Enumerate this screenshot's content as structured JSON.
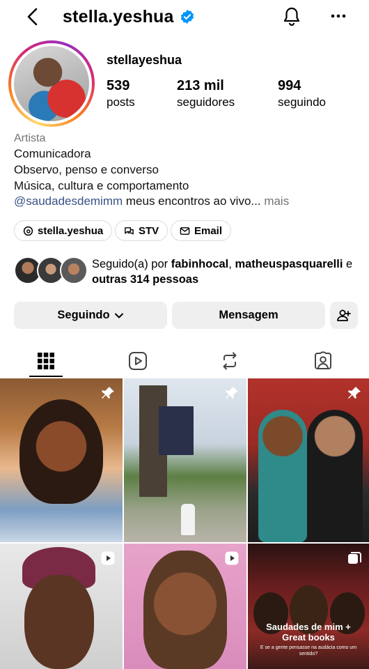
{
  "header": {
    "title": "stella.yeshua"
  },
  "profile": {
    "name": "stellayeshua",
    "stats": [
      {
        "value": "539",
        "label": "posts"
      },
      {
        "value": "213 mil",
        "label": "seguidores"
      },
      {
        "value": "994",
        "label": "seguindo"
      }
    ],
    "category": "Artista",
    "bio": [
      "Comunicadora",
      "Observo, penso e converso",
      "Música, cultura e comportamento"
    ],
    "bio_mention": "@saudadesdemimm",
    "bio_rest": " meus encontros ao vivo...",
    "bio_more": " mais"
  },
  "chips": [
    "stella.yeshua",
    "STV",
    "Email"
  ],
  "followed_by": {
    "prefix": "Seguido(a) por ",
    "user1": "fabinhocal",
    "sep": ",",
    "user2": "matheuspasquarelli",
    "mid": " e ",
    "rest": "outras 314 pessoas"
  },
  "actions": {
    "following": "Seguindo",
    "message": "Mensagem"
  },
  "grid": {
    "post6_title": "Saudades de mim + Great books",
    "post6_sub": "E se a gente pensasse na audácia como um sentido?"
  },
  "colors": {
    "verified": "#0095f6",
    "mention": "#385185",
    "button_bg": "#efefef"
  }
}
